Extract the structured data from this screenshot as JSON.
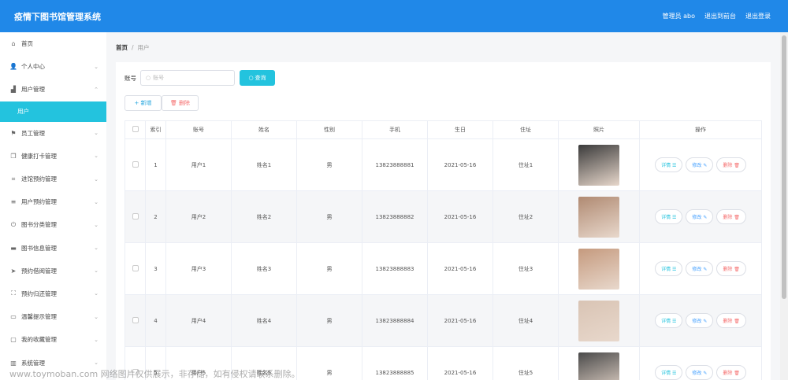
{
  "header": {
    "title": "疫情下图书馆管理系统",
    "admin": "管理员 abo",
    "back": "退出到前台",
    "logout": "退出登录"
  },
  "sidebar": {
    "items": [
      {
        "label": "首页",
        "icon": "home-icon",
        "glyph": "⌂"
      },
      {
        "label": "个人中心",
        "icon": "user-icon",
        "glyph": "👤",
        "chev": "⌄"
      },
      {
        "label": "用户管理",
        "icon": "chart-icon",
        "glyph": "▟",
        "chev": "⌃"
      },
      {
        "label": "用户",
        "active": true
      },
      {
        "label": "员工管理",
        "icon": "flag-icon",
        "glyph": "⚑",
        "chev": "⌄"
      },
      {
        "label": "健康打卡管理",
        "icon": "copy-icon",
        "glyph": "❐",
        "chev": "⌄"
      },
      {
        "label": "进馆预约管理",
        "icon": "crop-icon",
        "glyph": "⌗",
        "chev": "⌄"
      },
      {
        "label": "用户预约管理",
        "icon": "list-icon",
        "glyph": "≡",
        "chev": "⌄"
      },
      {
        "label": "图书分类管理",
        "icon": "power-icon",
        "glyph": "⏻",
        "chev": "⌄"
      },
      {
        "label": "图书信息管理",
        "icon": "message-icon",
        "glyph": "▬",
        "chev": "⌄"
      },
      {
        "label": "预约借阅管理",
        "icon": "send-icon",
        "glyph": "➤",
        "chev": "⌄"
      },
      {
        "label": "预约归还管理",
        "icon": "fullscreen-icon",
        "glyph": "⛶",
        "chev": "⌄"
      },
      {
        "label": "温馨提示管理",
        "icon": "monitor-icon",
        "glyph": "▭",
        "chev": "⌄"
      },
      {
        "label": "我的收藏管理",
        "icon": "chat-icon",
        "glyph": "▢",
        "chev": "⌄"
      },
      {
        "label": "系统管理",
        "icon": "stats-icon",
        "glyph": "▥",
        "chev": "⌄"
      }
    ]
  },
  "breadcrumb": {
    "home": "首页",
    "sep": "/",
    "current": "用户"
  },
  "search": {
    "label": "账号",
    "placeholder": "账号",
    "button": "查询"
  },
  "ops": {
    "add": "+ 新增",
    "delete": "🗑 删除"
  },
  "table": {
    "headers": [
      "",
      "索引",
      "账号",
      "姓名",
      "性别",
      "手机",
      "生日",
      "住址",
      "照片",
      "操作"
    ],
    "rows": [
      {
        "idx": "1",
        "account": "用户1",
        "name": "姓名1",
        "gender": "男",
        "phone": "13823888881",
        "birthday": "2021-05-16",
        "address": "住址1",
        "photo": "#3a3a3a"
      },
      {
        "idx": "2",
        "account": "用户2",
        "name": "姓名2",
        "gender": "男",
        "phone": "13823888882",
        "birthday": "2021-05-16",
        "address": "住址2",
        "photo": "#b08a72"
      },
      {
        "idx": "3",
        "account": "用户3",
        "name": "姓名3",
        "gender": "男",
        "phone": "13823888883",
        "birthday": "2021-05-16",
        "address": "住址3",
        "photo": "#c59a7e"
      },
      {
        "idx": "4",
        "account": "用户4",
        "name": "姓名4",
        "gender": "男",
        "phone": "13823888884",
        "birthday": "2021-05-16",
        "address": "住址4",
        "photo": "#d9c4b4"
      },
      {
        "idx": "5",
        "account": "用户5",
        "name": "姓名5",
        "gender": "男",
        "phone": "13823888885",
        "birthday": "2021-05-16",
        "address": "住址5",
        "photo": "#4a4a4a"
      }
    ],
    "actions": {
      "detail": "详情 ☰",
      "edit": "修改 ✎",
      "remove": "删除 🗑"
    }
  },
  "watermark": "www.toymoban.com 网络图片仅供展示，非存储，如有侵权请联系删除。",
  "colors": {
    "header": "#2088e8",
    "accent": "#23c3de",
    "danger": "#f56c6c"
  }
}
